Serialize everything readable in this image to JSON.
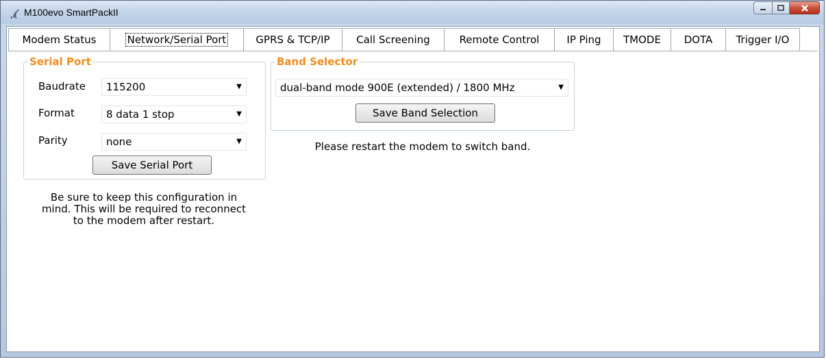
{
  "window": {
    "title": "M100evo SmartPackII",
    "controls": {
      "minimize": "minimize",
      "maximize": "maximize",
      "close": "close"
    }
  },
  "tabs": [
    {
      "label": "Modem Status",
      "active": false
    },
    {
      "label": "Network/Serial Port",
      "active": true
    },
    {
      "label": "GPRS & TCP/IP",
      "active": false
    },
    {
      "label": "Call Screening",
      "active": false
    },
    {
      "label": "Remote Control",
      "active": false
    },
    {
      "label": "IP Ping",
      "active": false
    },
    {
      "label": "TMODE",
      "active": false
    },
    {
      "label": "DOTA",
      "active": false
    },
    {
      "label": "Trigger I/O",
      "active": false
    }
  ],
  "serial_port": {
    "legend": "Serial Port",
    "baudrate_label": "Baudrate",
    "baudrate_value": "115200",
    "format_label": "Format",
    "format_value": "8 data 1 stop",
    "parity_label": "Parity",
    "parity_value": "none",
    "save_label": "Save Serial Port",
    "note_lines": [
      "Be sure to keep this configuration in",
      "mind. This will be required to reconnect",
      "to the modem after restart."
    ]
  },
  "band_selector": {
    "legend": "Band Selector",
    "selected": "dual-band mode 900E (extended) / 1800 MHz",
    "save_label": "Save Band Selection",
    "note": "Please restart the modem to switch band."
  },
  "colors": {
    "legend": "#f08c1e",
    "titlebar": "#c3d5ea",
    "close_button": "#c9503a"
  }
}
